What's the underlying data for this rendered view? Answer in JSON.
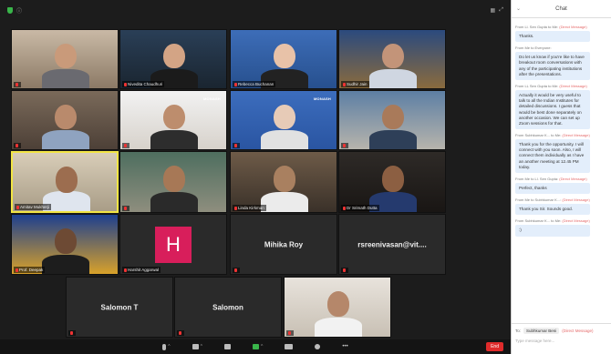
{
  "colors": {
    "active_speaker": "#f2e544",
    "end_button": "#e02b2b",
    "avatar_h": "#d81e5b",
    "chat_bubble": "#e3eefb"
  },
  "tiles": [
    {
      "name": ""
    },
    {
      "name": "Nivedita Chaudhuri"
    },
    {
      "name": "Rebecca Buchanan"
    },
    {
      "name": "Sudhir Jain"
    },
    {
      "name": ""
    },
    {
      "name": "",
      "logo": "MONASH"
    },
    {
      "name": "",
      "logo": "MONASH"
    },
    {
      "name": ""
    },
    {
      "name": "Amitav Mukherji"
    },
    {
      "name": ""
    },
    {
      "name": "Linda Kirkman"
    },
    {
      "name": "Dr Srimath Dutta"
    },
    {
      "name": "Aditya Singh"
    },
    {
      "name": ""
    },
    {
      "name": ""
    },
    {
      "name": "Dr Mukul Kumar"
    },
    {
      "name": "Prof. Deepak"
    },
    {
      "name": "Harshit Aggarwal",
      "initial": "H"
    },
    {
      "name": "",
      "center": "Mihika Roy"
    },
    {
      "name": "",
      "center": "rsreenivasan@vit...."
    },
    {
      "name": "",
      "center": "Salomon T"
    },
    {
      "name": "",
      "center": "Salomon"
    },
    {
      "name": ""
    }
  ],
  "toolbar": {
    "tools": [
      "Mute",
      "Participants",
      "Chat",
      "Share",
      "Record",
      "Reactions",
      "More"
    ],
    "end_label": "End"
  },
  "chat": {
    "title": "Chat",
    "messages": [
      {
        "from": "From Ll. Sen Gupta to Me:",
        "tag": "(Direct Message)",
        "text": "Thanks."
      },
      {
        "from": "From Me to Everyone:",
        "tag": "",
        "text": "Do let us know if you're like to have breakout room conversations with any of the participating institutions after the presentations."
      },
      {
        "from": "From LL Sen Gupta to Me:",
        "tag": "(Direct Message)",
        "text": "Actually it would be very useful to talk to all the Indian Institutes for detailed discussions. I guess that would be best done separately on another occasion. We can set up Zoom sessions for that."
      },
      {
        "from": "From Subhkumar K... to Me:",
        "tag": "(Direct Message)",
        "text": "Thank you for the opportunity. I will connect with you soon. Also, I will connect them individually as I have an another meeting at 12.45 PM today."
      },
      {
        "from": "From Me to Ll. Sen Gupta:",
        "tag": "(Direct Message)",
        "text": "Perfect, thanks"
      },
      {
        "from": "From Me to Subhkumar K...:",
        "tag": "(Direct Message)",
        "text": "Thank you Sir. Sounds good."
      },
      {
        "from": "From Subhkumar K... to Me:",
        "tag": "(Direct Message)",
        "text": ":)"
      }
    ],
    "to_label": "To:",
    "to_value": "Subhkumar Beni",
    "to_tag": "(Direct Message)",
    "placeholder": "Type message here..."
  }
}
